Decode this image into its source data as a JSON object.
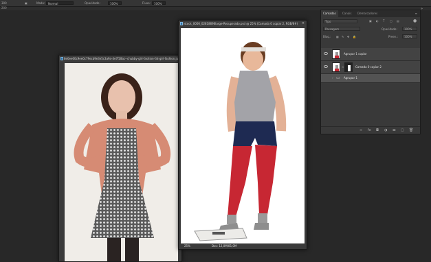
{
  "options_bar": {
    "size_value": "300",
    "mode_label": "Modo:",
    "mode_value": "Normal",
    "opacity_label": "Opacidade:",
    "opacity_value": "100%",
    "flow_label": "Fluxo:",
    "flow_value": "100%",
    "zoom_hint": "200"
  },
  "doc_left": {
    "title": "8e0ee00c9ee0c79ecb9e3e5c3a9a-4e7f28ac--chubby-girl-fashion-fat-girl-fashion.jpg",
    "close_glyph": "×"
  },
  "doc_right": {
    "title": "istock_0000_02818696large-Recuperado.psd @ 25% (Camada 0 copiar 2, RGB/8#)",
    "close_glyph": "×",
    "zoom": "25%",
    "doc_info": "Doc: 12,0M/81,0M"
  },
  "layers_panel": {
    "tabs": [
      "Camadas",
      "Canais",
      "Demarcadores"
    ],
    "filter_kind": "Tipo",
    "blend_mode": "Passagem",
    "opacity_label": "Opacidade:",
    "opacity_value": "100%",
    "lock_label": "Bloq.:",
    "fill_label": "Preen.:",
    "fill_value": "100%",
    "layers": [
      {
        "name": "Agrupar 1 copiar",
        "selected": false
      },
      {
        "name": "Camada 0 copiar 2",
        "selected": false
      },
      {
        "name": "Agrupar 1",
        "selected": true
      }
    ]
  },
  "colors": {
    "workspace": "#282828",
    "panel": "#393939",
    "accent": "#2c6d9e"
  }
}
